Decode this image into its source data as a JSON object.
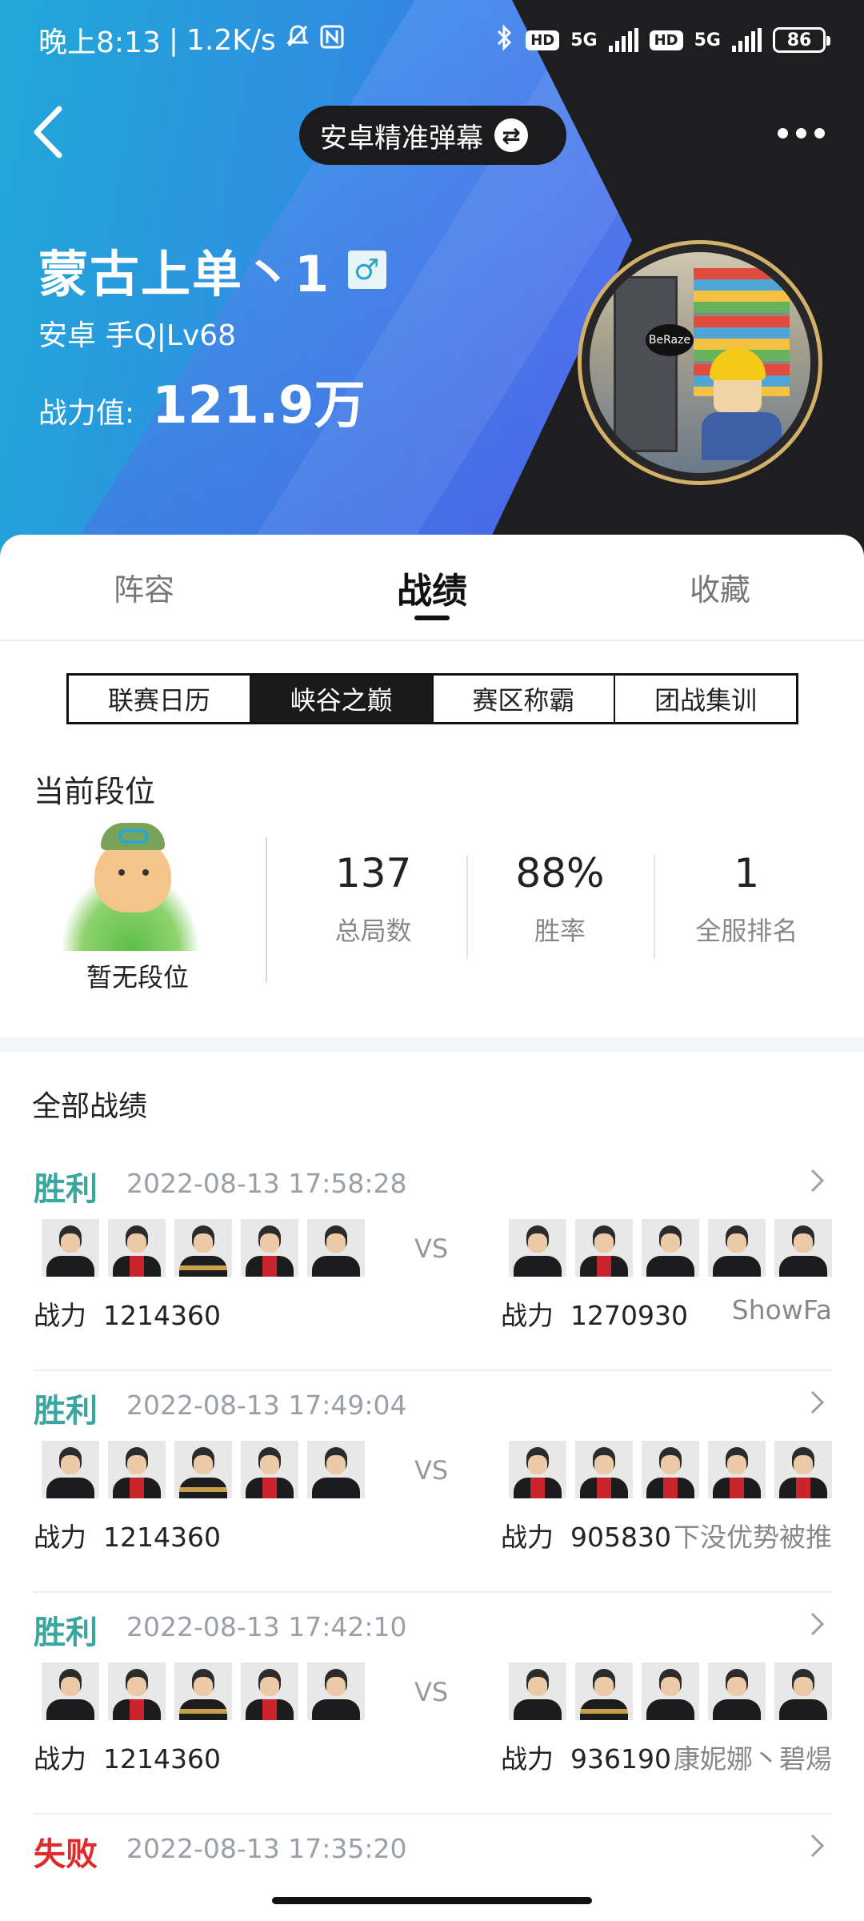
{
  "status_bar": {
    "time": "晚上8:13",
    "speed": "1.2K/s",
    "hd1": "HD",
    "net1": "5G",
    "hd2": "HD",
    "net2": "5G",
    "battery": "86"
  },
  "top": {
    "danmu_label": "安卓精准弹幕",
    "swap_icon": "⇄"
  },
  "profile": {
    "name": "蒙古上单丶1",
    "gender_icon": "♂",
    "platform": "安卓 手Q|Lv68",
    "power_label": "战力值:",
    "power_value": "121.9万",
    "avatar_text": "BeRaze"
  },
  "tabs": [
    {
      "label": "阵容"
    },
    {
      "label": "战绩"
    },
    {
      "label": "收藏"
    }
  ],
  "segments": [
    {
      "label": "联赛日历"
    },
    {
      "label": "峡谷之巅"
    },
    {
      "label": "赛区称霸"
    },
    {
      "label": "团战集训"
    }
  ],
  "rank": {
    "title": "当前段位",
    "none_label": "暂无段位",
    "stats": [
      {
        "value": "137",
        "label": "总局数"
      },
      {
        "value": "88%",
        "label": "胜率"
      },
      {
        "value": "1",
        "label": "全服排名"
      }
    ]
  },
  "records": {
    "title": "全部战绩",
    "vs": "VS",
    "power_label": "战力",
    "matches": [
      {
        "result": "胜利",
        "time": "2022-08-13 17:58:28",
        "left_power": "1214360",
        "right_power": "1270930",
        "nickname": "ShowFa"
      },
      {
        "result": "胜利",
        "time": "2022-08-13 17:49:04",
        "left_power": "1214360",
        "right_power": "905830",
        "nickname": "下没优势被推"
      },
      {
        "result": "胜利",
        "time": "2022-08-13 17:42:10",
        "left_power": "1214360",
        "right_power": "936190",
        "nickname": "康妮娜丶碧煬"
      },
      {
        "result": "失败",
        "time": "2022-08-13 17:35:20"
      }
    ]
  },
  "colors": {
    "win": "#3aa6a0",
    "lose": "#e02a2a",
    "header_blue": "#2e8fe0",
    "header_dark": "#1e1e20"
  }
}
